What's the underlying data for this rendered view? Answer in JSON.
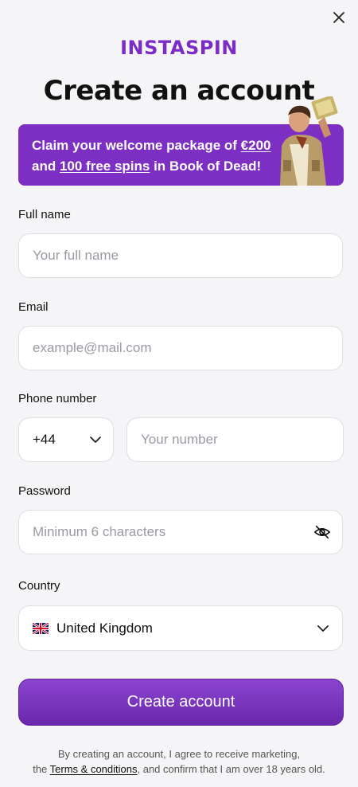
{
  "brand": {
    "logo_text": "INSTASPIN",
    "accent": "#7c2fc2"
  },
  "header": {
    "title": "Create an account"
  },
  "promo": {
    "text_1": "Claim your welcome package of ",
    "amount": "€200",
    "text_2": "and ",
    "spins": "100 free spins",
    "text_3": " in Book of Dead!"
  },
  "form": {
    "full_name": {
      "label": "Full name",
      "placeholder": "Your full name"
    },
    "email": {
      "label": "Email",
      "placeholder": "example@mail.com"
    },
    "phone": {
      "label": "Phone number",
      "code": "+44",
      "placeholder": "Your number"
    },
    "password": {
      "label": "Password",
      "placeholder": "Minimum 6 characters"
    },
    "country": {
      "label": "Country",
      "value": "United Kingdom",
      "flag_icon": "uk-flag-icon"
    }
  },
  "cta": {
    "label": "Create account"
  },
  "legal": {
    "line1": "By creating an account, I agree to receive marketing,",
    "pre": "the ",
    "link": "Terms & conditions",
    "post": ", and confirm that I am over 18 years old."
  },
  "icons": {
    "close": "close-icon",
    "chevron": "chevron-down-icon",
    "eye": "eye-off-icon"
  }
}
